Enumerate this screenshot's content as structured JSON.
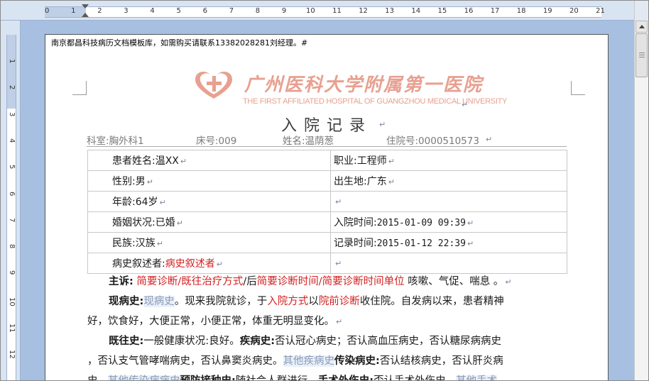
{
  "ruler": {
    "h_numbers": [
      "0",
      "1",
      "2",
      "3",
      "4",
      "5",
      "6",
      "7",
      "8",
      "9",
      "10",
      "11",
      "12",
      "13",
      "14",
      "15",
      "16",
      "17",
      "18",
      "19",
      "20",
      "21"
    ],
    "v_numbers": [
      "1",
      "2",
      "3",
      "4",
      "5",
      "6",
      "7",
      "8",
      "9",
      "10",
      "11",
      "12"
    ]
  },
  "header_note": "南京都昌科技病历文档模板库，如需购买请联系13382028281刘经理。#",
  "logo": {
    "cn": "广州医科大学附属第一医院",
    "en": "THE FIRST AFFILIATED HOSPITAL OF GUANGZHOU MEDICAL UNIVERSITY"
  },
  "title": "入院记录",
  "paragraph_mark": "↵",
  "infobar": {
    "dept": "科室:胸外科1",
    "bed": "床号:009",
    "name": "姓名:温荫葱",
    "admission_no": "住院号:0000510573"
  },
  "patient_table": [
    {
      "left": "患者姓名:温XX",
      "right": "职业:工程师"
    },
    {
      "left": "性别:男",
      "right": "出生地:广东"
    },
    {
      "left": "年龄:64岁",
      "right": ""
    },
    {
      "left": "婚姻状况:已婚",
      "right_label": "入院时间:",
      "right_value": "2015-01-09 09:39"
    },
    {
      "left": "民族:汉族",
      "right_label": "记录时间:",
      "right_value": "2015-01-12 22:39"
    },
    {
      "left_label": "病史叙述者:",
      "left_value": "病史叙述者",
      "right": ""
    }
  ],
  "body": {
    "chief_label": "主诉:",
    "chief_f1": "简要诊断/既往治疗方式",
    "chief_sep": "/后",
    "chief_f2": "简要诊断时间/简要诊断时间单位",
    "chief_text": " 咳嗽、气促、喘息 。",
    "present_label": "现病史:",
    "present_f1": "现病史",
    "present_t1": "。现来我院就诊，于",
    "present_f2": "入院方式",
    "present_t2": "以",
    "present_f3": "院前诊断",
    "present_t3": "收住院。自发病以来，患者精神",
    "present_line2": "好，饮食好，大便正常，小便正常，体重无明显变化。",
    "past_label": "既往史:",
    "past_t1": "一般健康状况:良好。",
    "disease_label": "疾病史:",
    "past_t2": "否认冠心病史；否认高血压病史，否认糖尿病病史",
    "past_line2_t1": "，否认支气管哮喘病史，否认鼻窦炎病史。",
    "past_f1": "其他疾病史",
    "infect_label": "传染病史:",
    "past_line2_t2": "否认结核病史，否认肝炎病",
    "past_line3_t1": "史。",
    "past_f2": "其他传染病病史",
    "vacc_label": "预防接种史:",
    "past_line3_t2": "随社会人群进行。",
    "surg_label": "手术外伤史:",
    "past_line3_t3": "否认手术外伤史。",
    "past_f3": "其他手术"
  }
}
